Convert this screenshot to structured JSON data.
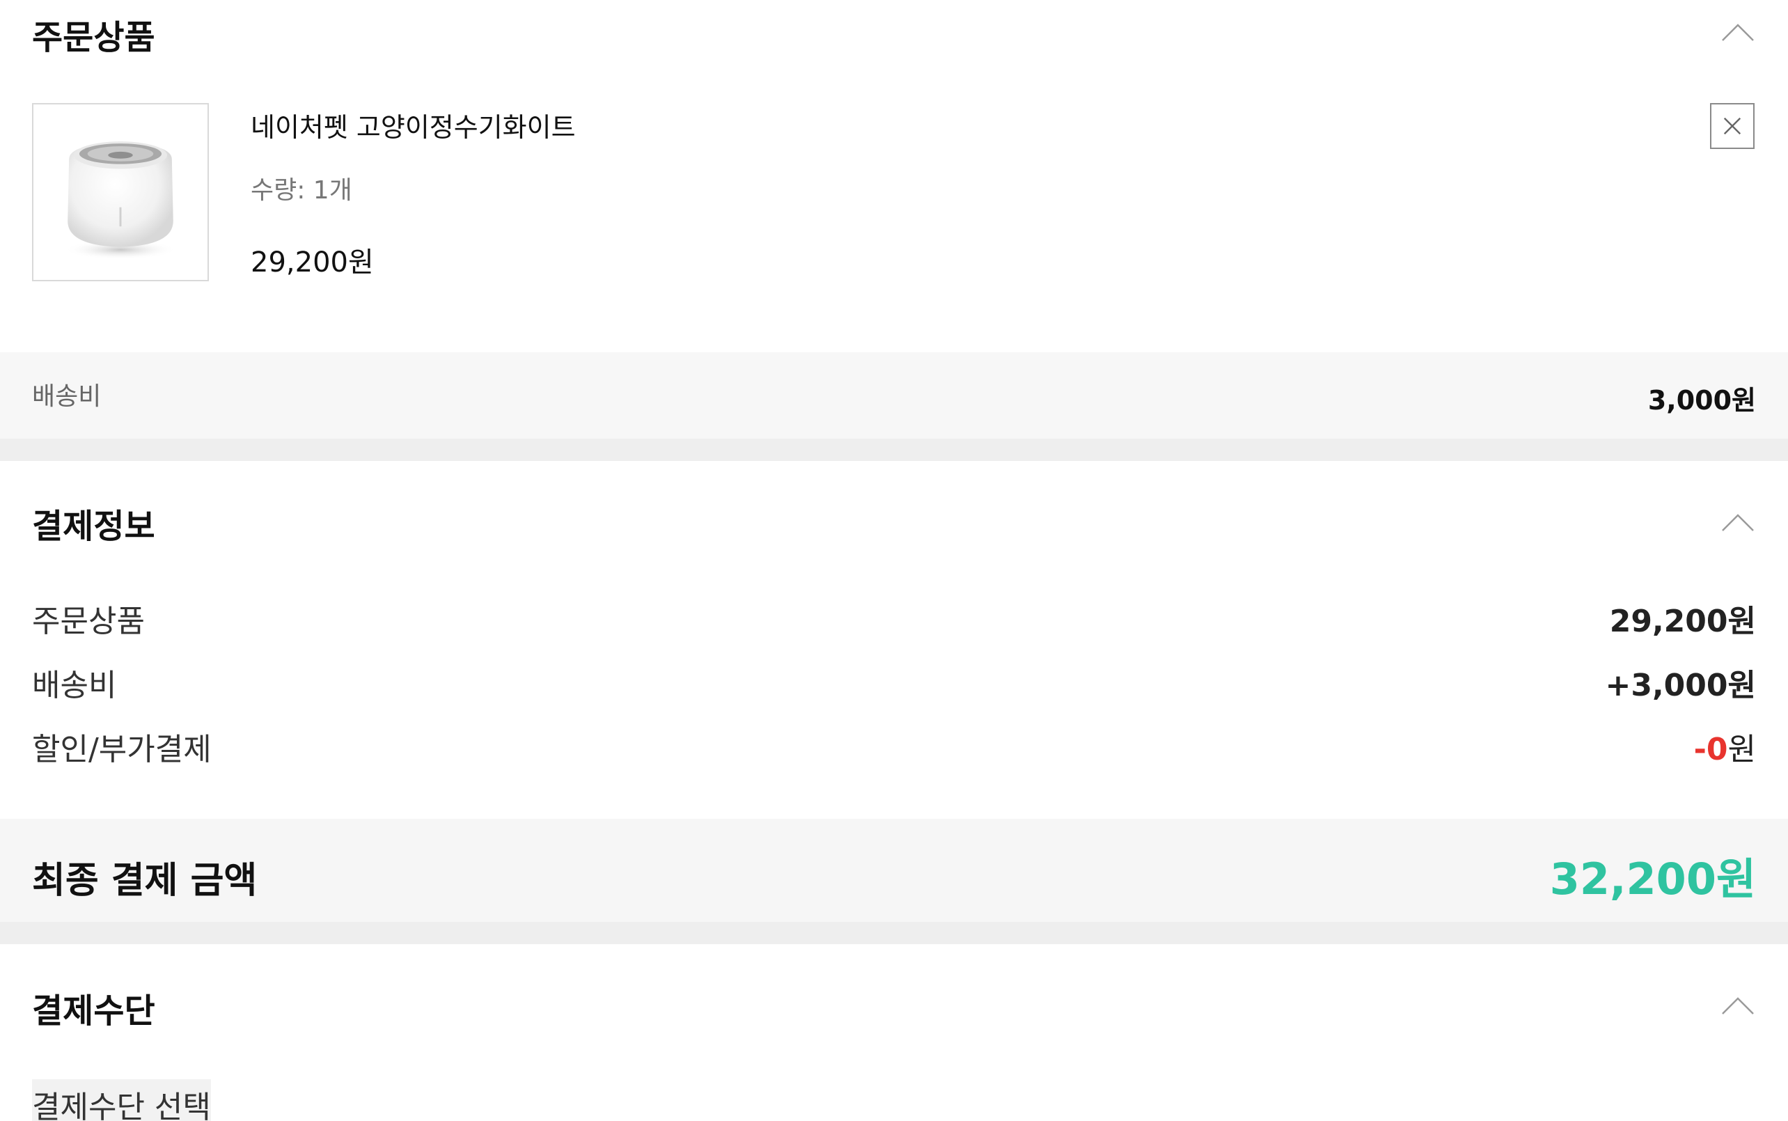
{
  "order_section": {
    "title": "주문상품",
    "collapse_icon": "chevron-up-icon",
    "product": {
      "name": "네이처펫 고양이정수기화이트",
      "quantity": "수량: 1개",
      "price": "29,200원",
      "image_icon": "pet-water-fountain-image",
      "remove_icon": "close-icon"
    },
    "shipping": {
      "label": "배송비",
      "value": "3,000원"
    }
  },
  "payment_info": {
    "title": "결제정보",
    "collapse_icon": "chevron-up-icon",
    "rows": [
      {
        "label": "주문상품",
        "value": "29,200원"
      },
      {
        "label": "배송비",
        "value": "+3,000원"
      },
      {
        "label": "할인/부가결제",
        "value_sign": "-0",
        "value_unit": "원"
      }
    ],
    "final": {
      "label": "최종 결제 금액",
      "value": "32,200원"
    }
  },
  "payment_method": {
    "title": "결제수단",
    "collapse_icon": "chevron-up-icon",
    "select_label": "결제수단 선택"
  },
  "colors": {
    "accent": "#2fc3a0",
    "discount": "#e8342e",
    "band": "#eeeeee",
    "panel": "#f7f7f7"
  }
}
